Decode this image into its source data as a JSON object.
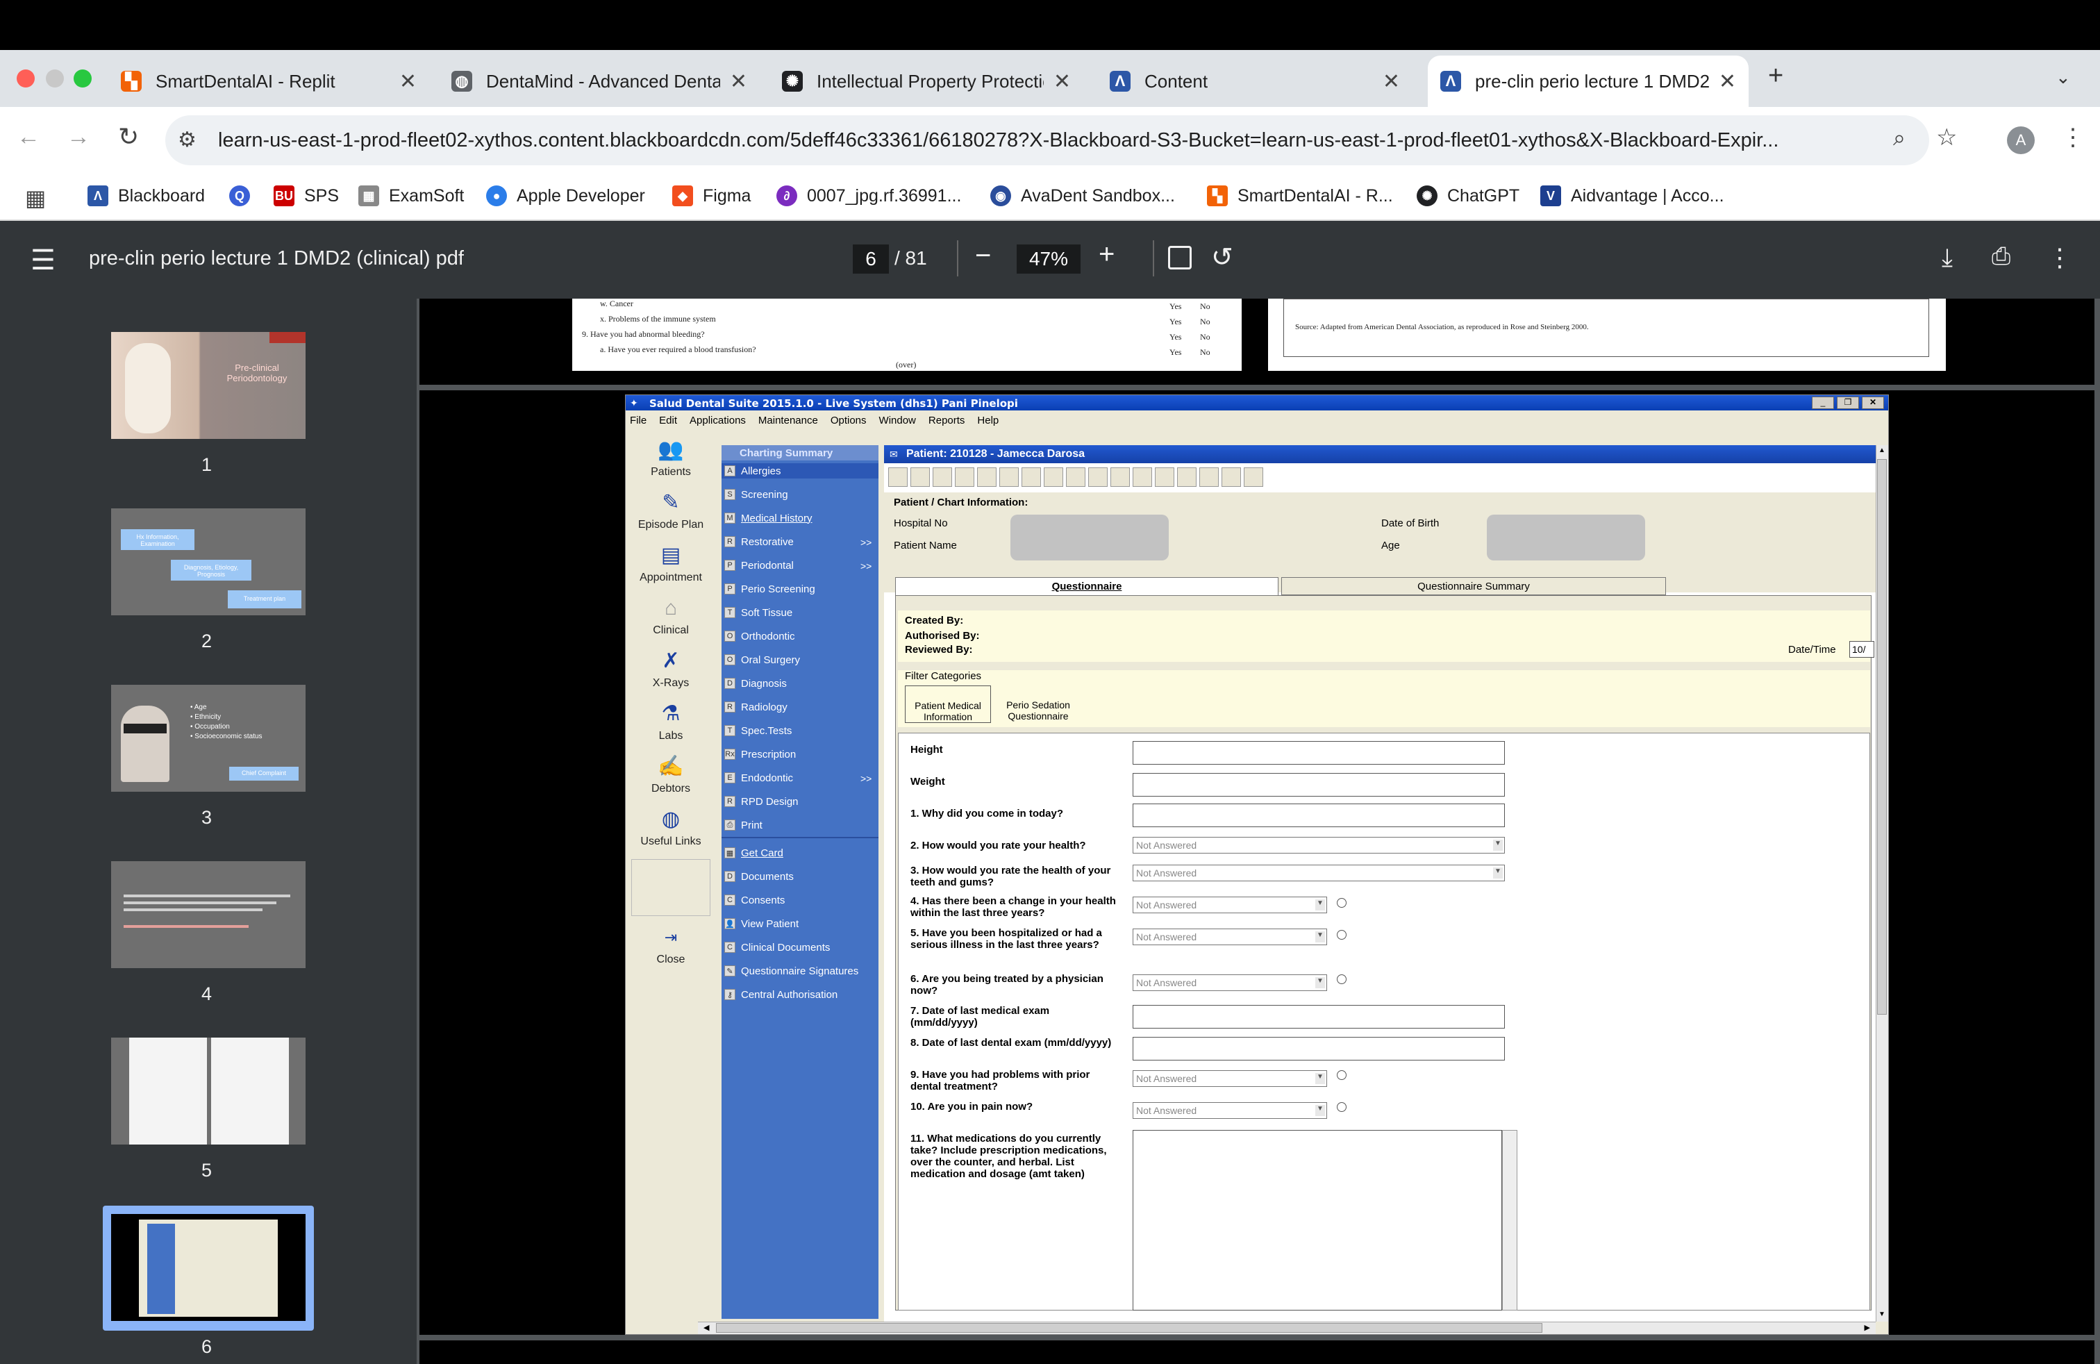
{
  "browser": {
    "tabs": [
      {
        "title": "SmartDentalAI - Replit",
        "icon_color": "#f26207"
      },
      {
        "title": "DentaMind - Advanced Denta",
        "icon_color": "#5f6368"
      },
      {
        "title": "Intellectual Property Protectio",
        "icon_color": "#202124"
      },
      {
        "title": "Content",
        "icon_color": "#2c57a7"
      },
      {
        "title": "pre-clin perio lecture 1 DMD2",
        "icon_color": "#2c57a7"
      }
    ],
    "new_tab": "+",
    "url": "learn-us-east-1-prod-fleet02-xythos.content.blackboardcdn.com/5deff46c33361/66180278?X-Blackboard-S3-Bucket=learn-us-east-1-prod-fleet01-xythos&X-Blackboard-Expir...",
    "profile": "A",
    "bookmarks": [
      {
        "label": "Blackboard",
        "glyph": "Λ",
        "color": "#2c57a7"
      },
      {
        "label": "",
        "glyph": "Q",
        "color": "#3a5fd6"
      },
      {
        "label": "SPS",
        "glyph": "BU",
        "color": "#cc0000"
      },
      {
        "label": "ExamSoft",
        "glyph": "▦",
        "color": "#777777"
      },
      {
        "label": "Apple Developer",
        "glyph": "●",
        "color": "#2b7de9"
      },
      {
        "label": "Figma",
        "glyph": "◆",
        "color": "#f24e1e"
      },
      {
        "label": "0007_jpg.rf.36991...",
        "glyph": "∂",
        "color": "#7b2cbf"
      },
      {
        "label": "AvaDent Sandbox...",
        "glyph": "◉",
        "color": "#2a4d9b"
      },
      {
        "label": "SmartDentalAI - R...",
        "glyph": "▚",
        "color": "#f26207"
      },
      {
        "label": "ChatGPT",
        "glyph": "✺",
        "color": "#202124"
      },
      {
        "label": "Aidvantage | Acco...",
        "glyph": "V",
        "color": "#1d3f8f"
      }
    ]
  },
  "pdf": {
    "title": "pre-clin perio lecture 1 DMD2 (clinical) pdf",
    "page_current": "6",
    "page_total": "/ 81",
    "zoom": "47%",
    "thumbnails": [
      "1",
      "2",
      "3",
      "4",
      "5",
      "6"
    ],
    "thumb_texts": {
      "t1": "Pre-clinical Periodontology",
      "t2a": "Hx Information, Examination",
      "t2b": "Diagnosis, Etiology, Prognosis",
      "t2c": "Treatment plan",
      "t3a": "• Age",
      "t3b": "• Ethnicity",
      "t3c": "• Occupation",
      "t3d": "• Socioeconomic status",
      "t3e": "Chief Complaint"
    },
    "prev_page": {
      "line_w": "w.   Cancer",
      "line_x": "x.   Problems of the immune system",
      "line_9": "9.  Have you had abnormal bleeding?",
      "line_a": "a.   Have you ever required a blood transfusion?",
      "over": "(over)",
      "yes": "Yes",
      "no": "No",
      "source": "Source:  Adapted from American Dental Association, as reproduced in Rose and Steinberg 2000."
    }
  },
  "app": {
    "window_title": "Salud Dental Suite 2015.1.0 - Live System (dhs1) Pani Pinelopi",
    "menu": [
      "File",
      "Edit",
      "Applications",
      "Maintenance",
      "Options",
      "Window",
      "Reports",
      "Help"
    ],
    "left_icons": [
      "Patients",
      "Episode Plan",
      "Appointment",
      "Clinical",
      "X-Rays",
      "Labs",
      "Debtors",
      "Useful Links",
      "Close"
    ],
    "panel_header": "Charting Summary",
    "panel_items": [
      "Allergies",
      "Screening",
      "Medical History",
      "Restorative",
      "Periodontal",
      "Perio Screening",
      "Soft Tissue",
      "Orthodontic",
      "Oral Surgery",
      "Diagnosis",
      "Radiology",
      "Spec.Tests",
      "Prescription",
      "Endodontic",
      "RPD Design",
      "Print"
    ],
    "panel_items2": [
      "Get Card",
      "Documents",
      "Consents",
      "View Patient",
      "Clinical Documents",
      "Questionnaire Signatures",
      "Central Authorisation"
    ],
    "more": ">>",
    "patient_header": "Patient: 210128 - Jamecca Darosa",
    "chart_info": "Patient / Chart Information:",
    "hospital_no": "Hospital No",
    "patient_name": "Patient Name",
    "dob": "Date of Birth",
    "age": "Age",
    "tab_q": "Questionnaire",
    "tab_qs": "Questionnaire Summary",
    "created_by": "Created By:",
    "authorised_by": "Authorised By:",
    "reviewed_by": "Reviewed By:",
    "date_time": "Date/Time",
    "date_val": "10/",
    "filter": "Filter Categories",
    "cat1": "Patient Medical Information",
    "cat2": "Perio Sedation Questionnaire",
    "questions": [
      "Height",
      "Weight",
      "1. Why did you come in today?",
      "2. How would you rate your health?",
      "3. How would you rate the health of your teeth and gums?",
      "4. Has there been a change in your health within the last three years?",
      "5. Have you been hospitalized or had a serious illness in the last three years?",
      "6. Are you being treated by a physician now?",
      "7. Date of last medical exam (mm/dd/yyyy)",
      "8. Date of last dental exam (mm/dd/yyyy)",
      "9. Have you had problems with prior dental treatment?",
      "10. Are you in pain now?",
      "11. What medications do you currently take? Include prescription medications, over the counter, and herbal. List medication and dosage (amt taken)"
    ],
    "not_answered": "Not Answered"
  }
}
